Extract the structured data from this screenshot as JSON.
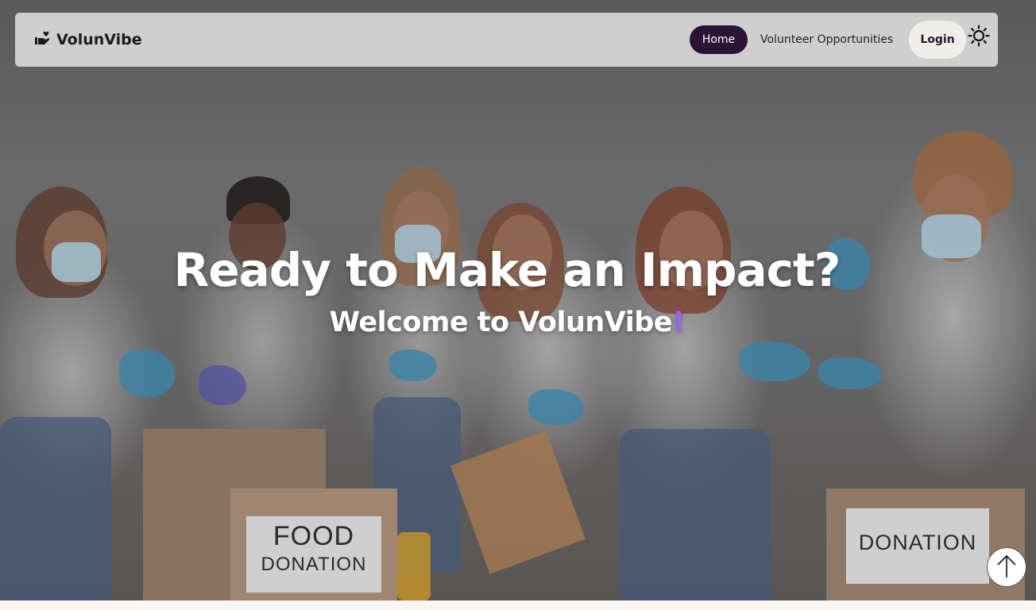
{
  "brand": {
    "name": "VolunVibe",
    "logo_icon": "hand-heart-icon"
  },
  "nav": {
    "items": [
      {
        "label": "Home",
        "active": true
      },
      {
        "label": "Volunteer Opportunities",
        "active": false
      }
    ],
    "login_label": "Login",
    "theme_icon": "sun-icon"
  },
  "hero": {
    "title": "Ready to Make an Impact?",
    "subtitle_main": "Welcome to VolunVibe",
    "subtitle_accent": "!",
    "background": "volunteers-packing-food-donation-photo",
    "box_labels": {
      "food_line1": "FOOD",
      "food_line2": "DONATION",
      "donation_right": "DONATION"
    }
  },
  "scroll_top_icon": "arrow-up-icon",
  "colors": {
    "nav_active_bg": "#2b1336",
    "accent_exclamation": "#a05cff",
    "navbar_bg": "#cfcfcf",
    "login_bg": "#f1ede8",
    "page_bg": "#faf6f3"
  }
}
